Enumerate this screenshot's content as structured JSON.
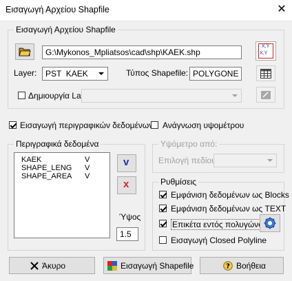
{
  "window": {
    "title": "Εισαγωγή Αρχείου Shapfile",
    "close_glyph": "✕"
  },
  "file_group": {
    "legend": "Εισαγωγή Αρχείου Shapfile",
    "path_value": "G:\\Mykonos_Mpliatsos\\cad\\shp\\KAEK.shp",
    "layer_label": "Layer:",
    "layer_value": "PST  KAEK",
    "shapefile_type_label": "Τύπος Shapefile:",
    "shapefile_type_value": "POLYGONE",
    "create_layers_label": "Δημιουργία Layers:",
    "create_layers_checked": false,
    "xy_icon_text_top": "X,Y",
    "xy_icon_text_bottom": "X,Y"
  },
  "options": {
    "import_descriptive_label": "Εισαγωγή περιγραφικών δεδομένων",
    "import_descriptive_checked": true,
    "read_elevation_label": "Ανάγνωση υψομέτρου",
    "read_elevation_checked": false
  },
  "descriptive_group": {
    "legend": "Περιγραφικά δεδομένα",
    "fields": [
      {
        "name": "KAEK",
        "flag": "V"
      },
      {
        "name": "SHAPE_LENG",
        "flag": "V"
      },
      {
        "name": "SHAPE_AREA",
        "flag": "V"
      }
    ],
    "v_button": "v",
    "x_button": "x",
    "height_label": "Ύψος",
    "height_value": "1.5"
  },
  "elevation_group": {
    "legend": "Υψόμετρο από:",
    "field_select_label": "Επιλογή πεδίου:"
  },
  "display_group": {
    "legend": "Ρυθμίσεις",
    "items": [
      {
        "label": "Εμφάνιση δεδομένων ως Blocks",
        "checked": true
      },
      {
        "label": "Εμφάνιση δεδομένων ως TEXT",
        "checked": true
      },
      {
        "label": "Επικέτα εντός πολυγώνου",
        "checked": true
      },
      {
        "label": "Εισαγωγή Closed Polyline",
        "checked": false
      }
    ]
  },
  "footer": {
    "cancel_label": "Άκυρο",
    "import_label": "Εισαγωγή Shapefile",
    "help_label": "Βοήθεια"
  },
  "colors": {
    "blue_v": "#1a2fb0",
    "red_x": "#e02020",
    "folder_yellow": "#e8b830"
  }
}
